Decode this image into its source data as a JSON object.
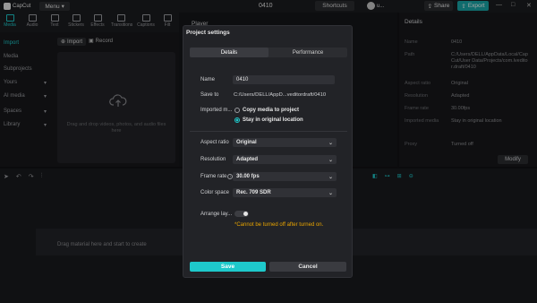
{
  "app": {
    "logo_text": "CapCut",
    "menu_label": "Menu",
    "project_title": "0410"
  },
  "topbar": {
    "shortcuts_label": "Shortcuts",
    "user_name": "u...",
    "share_label": "Share",
    "export_label": "Export",
    "win_min": "—",
    "win_max": "□",
    "win_close": "✕"
  },
  "toolbar": {
    "items": [
      {
        "label": "Media"
      },
      {
        "label": "Audio"
      },
      {
        "label": "Text"
      },
      {
        "label": "Stickers"
      },
      {
        "label": "Effects"
      },
      {
        "label": "Transitions"
      },
      {
        "label": "Captions"
      },
      {
        "label": "Filt"
      }
    ]
  },
  "sidenav": {
    "import": "Import",
    "items": [
      {
        "label": "Media"
      },
      {
        "label": "Subprojects"
      },
      {
        "label": "Yours"
      },
      {
        "label": "AI media"
      },
      {
        "label": "Spaces"
      },
      {
        "label": "Library"
      }
    ]
  },
  "media": {
    "import_label": "Import",
    "record_label": "Record",
    "drop_text": "Drag and drop videos, photos, and audio files here"
  },
  "player": {
    "label": "Player"
  },
  "details": {
    "title": "Details",
    "rows": [
      {
        "label": "Name",
        "value": "0410"
      },
      {
        "label": "Path",
        "value": "C:/Users/DELL/AppData/Local/CapCut/User Data/Projects/com.lveditor.draft/0410"
      },
      {
        "label": "Aspect ratio",
        "value": "Original"
      },
      {
        "label": "Resolution",
        "value": "Adapted"
      },
      {
        "label": "Frame rate",
        "value": "30.00fps"
      },
      {
        "label": "Imported media",
        "value": "Stay in original location"
      },
      {
        "label": "Proxy",
        "value": "Turned off"
      }
    ],
    "modify_label": "Modify"
  },
  "timeline": {
    "drag_text": "Drag material here and start to create"
  },
  "modal": {
    "title": "Project settings",
    "tabs": [
      {
        "label": "Details"
      },
      {
        "label": "Performance"
      }
    ],
    "name_label": "Name",
    "name_value": "0410",
    "save_to_label": "Save to",
    "save_to_value": "C:/Users/DELL/AppD...veditordraft/0410",
    "imported_label": "Imported m...",
    "radio_copy": "Copy media to project",
    "radio_stay": "Stay in original location",
    "aspect_label": "Aspect ratio",
    "aspect_value": "Original",
    "resolution_label": "Resolution",
    "resolution_value": "Adapted",
    "framerate_label": "Frame rate",
    "framerate_value": "30.00 fps",
    "colorspace_label": "Color space",
    "colorspace_value": "Rec. 709 SDR",
    "arrange_label": "Arrange lay...",
    "warning": "*Cannot be turned off after turned on.",
    "save_label": "Save",
    "cancel_label": "Cancel"
  },
  "colors": {
    "accent": "#1ec9cb",
    "warning": "#e8a400"
  }
}
